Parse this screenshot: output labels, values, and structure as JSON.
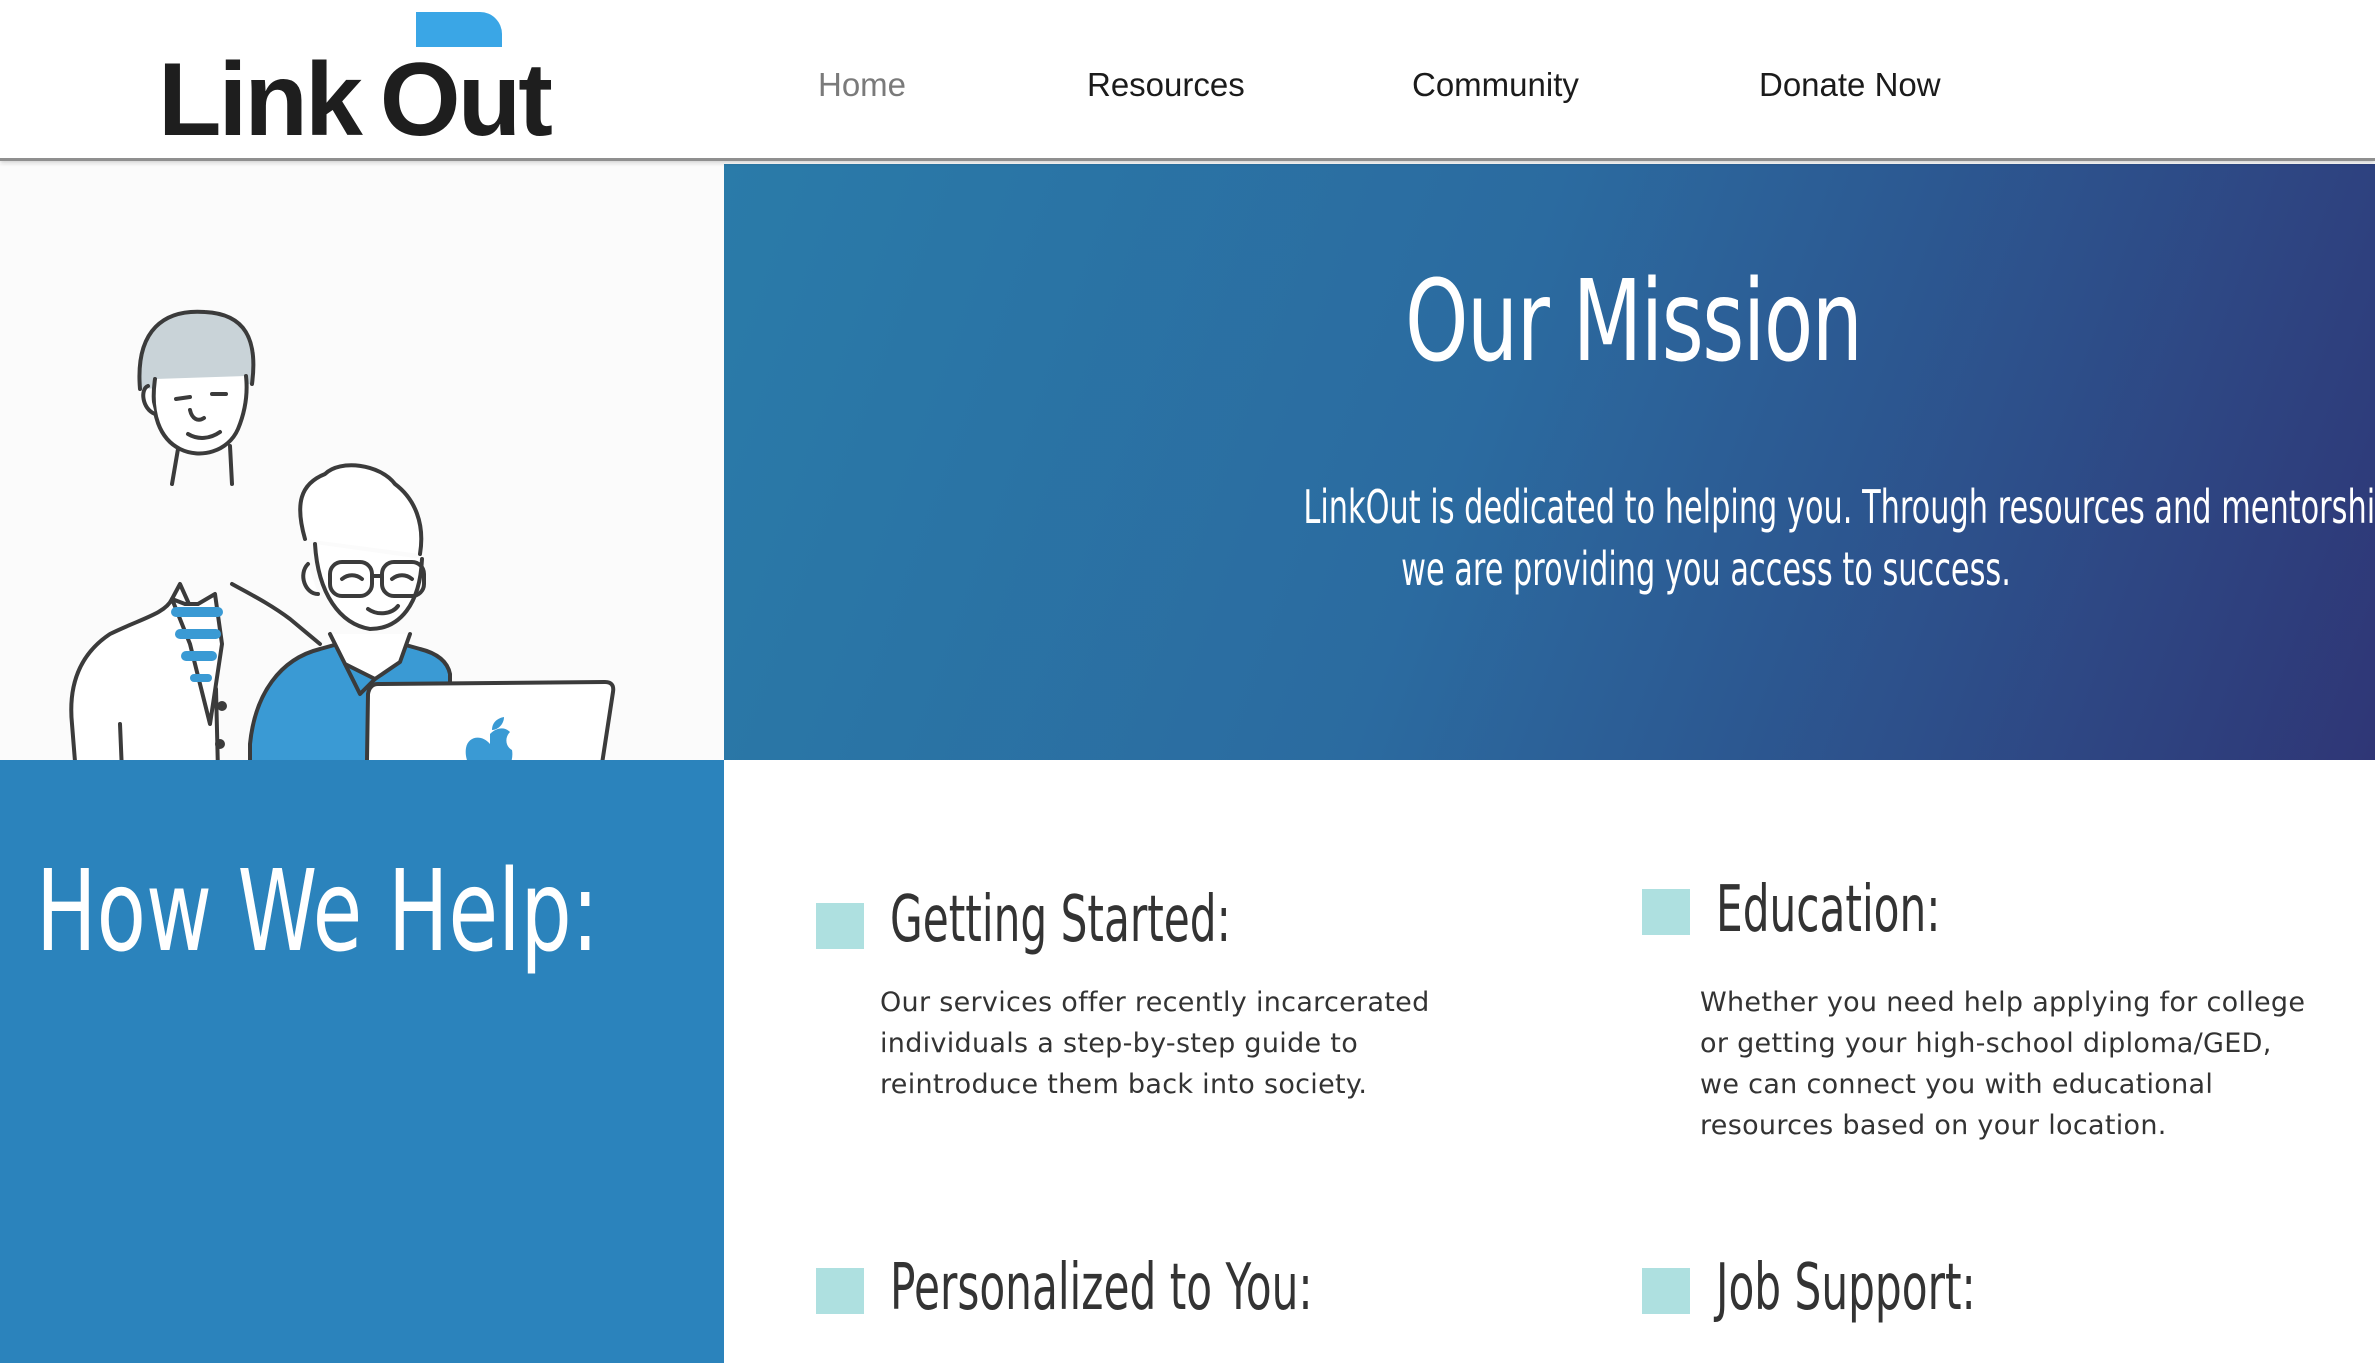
{
  "header": {
    "logo_text_1": "Link",
    "logo_text_2": "Out",
    "nav": [
      {
        "label": "Home",
        "active": true
      },
      {
        "label": "Resources",
        "active": false
      },
      {
        "label": "Community",
        "active": false
      },
      {
        "label": "Donate Now",
        "active": false
      }
    ]
  },
  "mission": {
    "title": "Our Mission",
    "body_line1": "LinkOut is dedicated to helping you. Through resources and mentorship,",
    "body_line2": "we are providing you access to success."
  },
  "help": {
    "title": "How We Help:",
    "cards": [
      {
        "title": "Getting Started:",
        "lines": [
          "Our services offer recently incarcerated",
          "individuals a step-by-step guide to",
          "reintroduce them back into society."
        ]
      },
      {
        "title": "Education:",
        "lines": [
          "Whether you need help applying for college",
          "or getting your high-school diploma/GED,",
          "we can connect you with educational",
          "resources based on your location."
        ]
      },
      {
        "title": "Personalized to You:",
        "lines": []
      },
      {
        "title": "Job Support:",
        "lines": []
      }
    ]
  },
  "colors": {
    "accent_blue": "#2b83bc",
    "logo_blue": "#3aa6e6",
    "bullet_teal": "#aee0e0",
    "mission_gradient_start": "#2a7ba9",
    "mission_gradient_end": "#2f3676"
  },
  "icons": {
    "illustration": "two-people-with-laptop-illustration",
    "laptop_logo": "apple-icon"
  }
}
